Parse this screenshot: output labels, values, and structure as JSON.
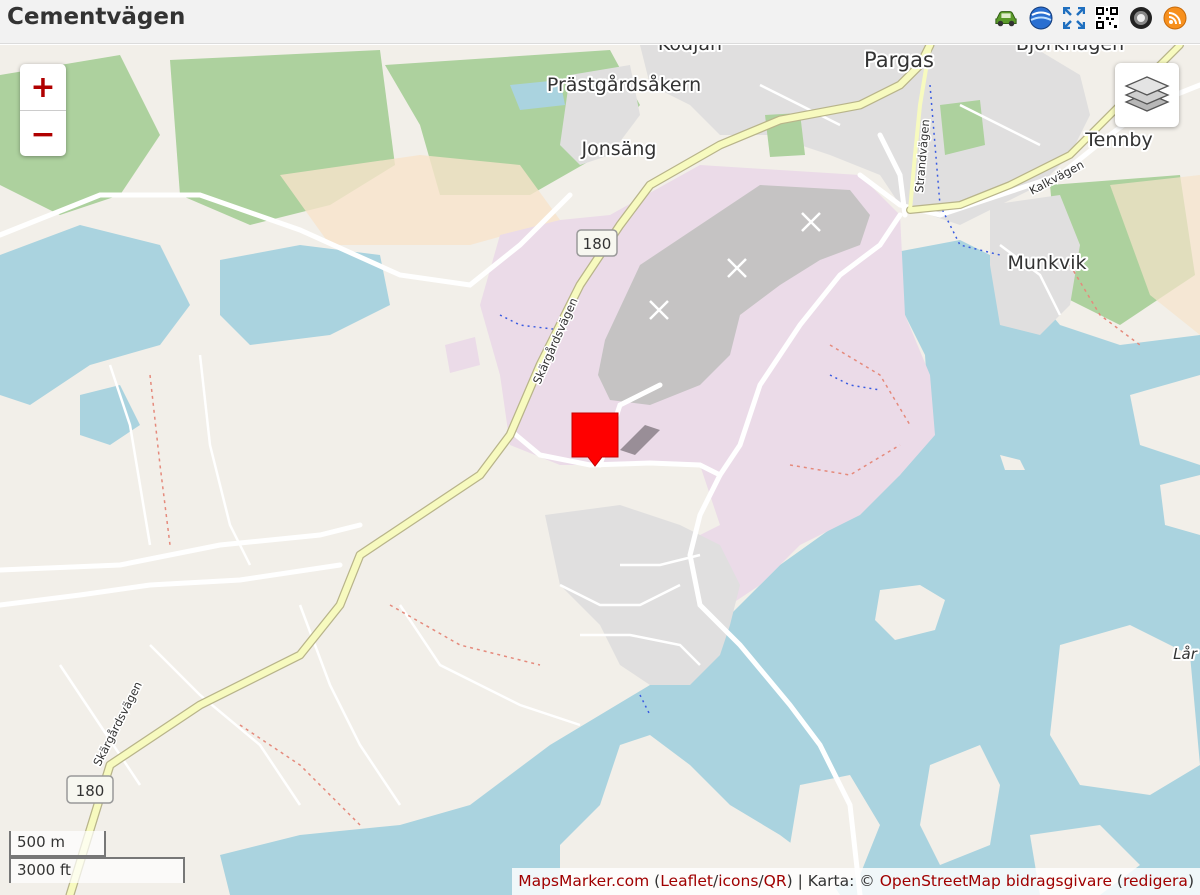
{
  "window": {
    "title": "Cementvägen"
  },
  "toolbar": {
    "icons": [
      "car-icon",
      "google-earth-icon",
      "fullscreen-icon",
      "qr-code-icon",
      "geo-rss-icon",
      "rss-icon"
    ]
  },
  "map": {
    "place_labels": {
      "pargas": "Pargas",
      "prastgardsakern": "Prästgårdsåkern",
      "jonsang": "Jonsäng",
      "tennby": "Tennby",
      "munkvik": "Munkvik",
      "kodjan": "Kodjan",
      "bjorkhagen": "Björkhagen",
      "lar": "Lår"
    },
    "road_labels": {
      "skargardsvagen_1": "Skärgårdsvägen",
      "skargardsvagen_2": "Skärgårdsvägen",
      "strandvagen": "Strandvägen",
      "kalkvagen": "Kalkvägen"
    },
    "route_shields": {
      "shield_1": "180",
      "shield_2": "180"
    },
    "controls": {
      "zoom_in": "+",
      "zoom_out": "−"
    },
    "scale": {
      "metric": "500 m",
      "imperial": "3000 ft"
    },
    "attribution": {
      "mapsmarker": "MapsMarker.com",
      "open_paren": " (",
      "leaflet": "Leaflet",
      "slash1": "/",
      "icons": "icons",
      "slash2": "/",
      "qr": "QR",
      "karta": ") | Karta: © ",
      "osm": "OpenStreetMap bidragsgivare",
      "space_paren": " (",
      "redigera": "redigera",
      "close_paren": ")"
    },
    "marker": {
      "color": "#ff0000"
    },
    "colors": {
      "land": "#f2efe9",
      "water": "#aad3df",
      "forest": "#add19e",
      "industrial": "#ebdbe8",
      "quarry": "#c5c3c3",
      "road_primary": "#f7fabf",
      "residential": "#e0dfdf"
    }
  }
}
